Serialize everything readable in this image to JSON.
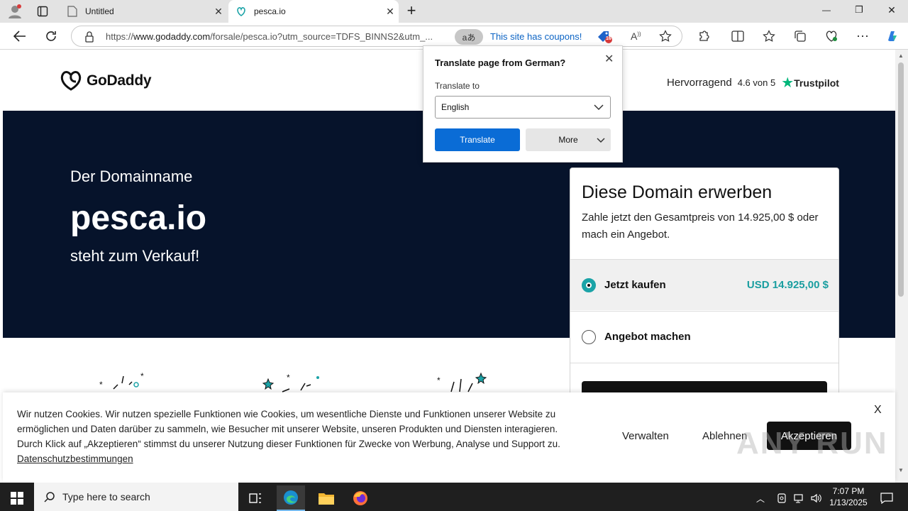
{
  "browser": {
    "tabs": [
      {
        "label": "Untitled",
        "close": "✕"
      },
      {
        "label": "pesca.io",
        "close": "✕"
      }
    ],
    "new_tab": "+",
    "url_prefix": "https://",
    "url_domain": "www.godaddy.com",
    "url_path": "/forsale/pesca.io?utm_source=TDFS_BINNS2&utm_...",
    "translate_pill": "aあ",
    "coupon_text": "This site has coupons!",
    "coupon_badge": "16",
    "window_controls": {
      "minimize": "—",
      "restore": "❐",
      "close": "✕"
    }
  },
  "translate_popup": {
    "title": "Translate page from German?",
    "translate_to_label": "Translate to",
    "selected_language": "English",
    "translate_button": "Translate",
    "more_button": "More",
    "close": "✕"
  },
  "site": {
    "logo_text": "GoDaddy",
    "trust_rating_word": "Hervorragend",
    "trust_score": "4.6 von 5",
    "trustpilot": "Trustpilot",
    "hero_pre": "Der Domainname",
    "hero_domain": "pesca.io",
    "hero_post": "steht zum Verkauf!",
    "buy_title": "Diese Domain erwerben",
    "buy_desc": "Zahle jetzt den Gesamtpreis von 14.925,00 $ oder mach ein Angebot.",
    "option_buy_label": "Jetzt kaufen",
    "option_buy_price": "USD 14.925,00 $",
    "option_offer_label": "Angebot machen"
  },
  "cookie": {
    "text": "Wir nutzen Cookies. Wir nutzen spezielle Funktionen wie Cookies, um wesentliche Dienste und Funktionen unserer Website zu ermöglichen und Daten darüber zu sammeln, wie Besucher mit unserer Website, unseren Produkten und Diensten interagieren. Durch Klick auf „Akzeptieren“ stimmst du unserer Nutzung dieser Funktionen für Zwecke von Werbung, Analyse und Support zu.",
    "link": "Datenschutzbestimmungen",
    "manage": "Verwalten",
    "reject": "Ablehnen",
    "accept": "Akzeptieren",
    "close": "X"
  },
  "taskbar": {
    "search_placeholder": "Type here to search",
    "time": "7:07 PM",
    "date": "1/13/2025"
  },
  "watermark": "ANY RUN",
  "colors": {
    "hero_bg": "#06132b",
    "accent_teal": "#1a9ea0",
    "translate_blue": "#0a6cd6"
  }
}
